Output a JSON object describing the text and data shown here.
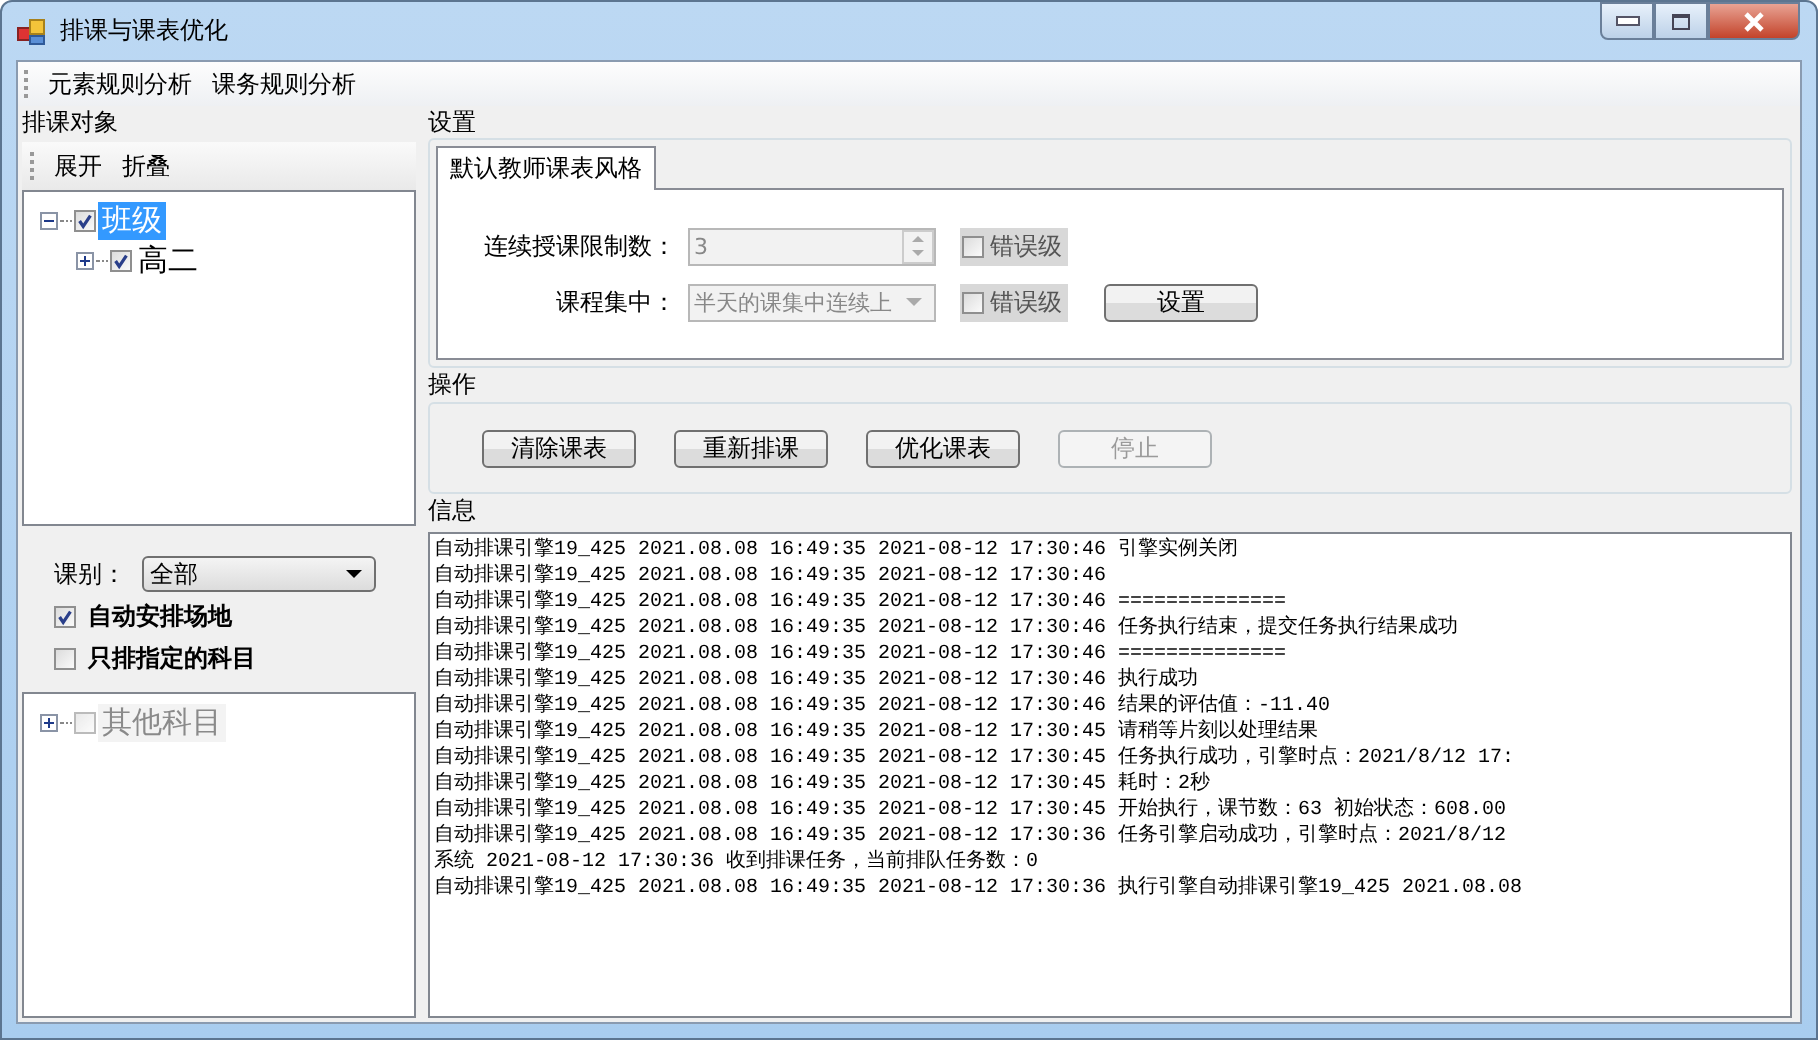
{
  "window": {
    "title": "排课与课表优化"
  },
  "menu": [
    "元素规则分析",
    "课务规则分析"
  ],
  "left": {
    "title": "排课对象",
    "toolbar": [
      "展开",
      "折叠"
    ],
    "tree": [
      {
        "label": "班级",
        "checked": true,
        "selected": true,
        "expanded": true,
        "children": [
          {
            "label": "高二",
            "checked": true,
            "selected": false,
            "expanded": false
          }
        ]
      }
    ],
    "category": {
      "label": "课别：",
      "value": "全部"
    },
    "options": [
      {
        "label": "自动安排场地",
        "checked": true
      },
      {
        "label": "只排指定的科目",
        "checked": false
      }
    ],
    "subject_tree": [
      {
        "label": "其他科目",
        "checked": false,
        "selected": false,
        "expanded": false,
        "disabled": true
      }
    ]
  },
  "settings": {
    "title": "设置",
    "tabs": [
      {
        "label": "默认教师课表风格",
        "selected": true
      }
    ],
    "fields": [
      {
        "kind": "spinner",
        "label": "连续授课限制数：",
        "value": "3",
        "disabled": true,
        "error_level": {
          "label": "错误级",
          "checked": false
        }
      },
      {
        "kind": "dropdown",
        "label": "课程集中：",
        "value": "半天的课集中连续上",
        "disabled": true,
        "error_level": {
          "label": "错误级",
          "checked": false
        }
      }
    ],
    "button": "设置"
  },
  "operations": {
    "title": "操作",
    "buttons": [
      {
        "label": "清除课表",
        "disabled": false
      },
      {
        "label": "重新排课",
        "disabled": false
      },
      {
        "label": "优化课表",
        "disabled": false
      },
      {
        "label": "停止",
        "disabled": true
      }
    ]
  },
  "info": {
    "title": "信息",
    "lines": [
      "自动排课引擎19_425 2021.08.08 16:49:35 2021-08-12 17:30:46 引擎实例关闭",
      "自动排课引擎19_425 2021.08.08 16:49:35 2021-08-12 17:30:46",
      "自动排课引擎19_425 2021.08.08 16:49:35 2021-08-12 17:30:46 ==============",
      "自动排课引擎19_425 2021.08.08 16:49:35 2021-08-12 17:30:46 任务执行结束，提交任务执行结果成功",
      "自动排课引擎19_425 2021.08.08 16:49:35 2021-08-12 17:30:46 ==============",
      "自动排课引擎19_425 2021.08.08 16:49:35 2021-08-12 17:30:46 执行成功",
      "自动排课引擎19_425 2021.08.08 16:49:35 2021-08-12 17:30:46 结果的评估值：-11.40",
      "自动排课引擎19_425 2021.08.08 16:49:35 2021-08-12 17:30:45 请稍等片刻以处理结果",
      "自动排课引擎19_425 2021.08.08 16:49:35 2021-08-12 17:30:45 任务执行成功，引擎时点：2021/8/12 17:",
      "自动排课引擎19_425 2021.08.08 16:49:35 2021-08-12 17:30:45 耗时：2秒",
      "自动排课引擎19_425 2021.08.08 16:49:35 2021-08-12 17:30:45 开始执行，课节数：63 初始状态：608.00",
      "自动排课引擎19_425 2021.08.08 16:49:35 2021-08-12 17:30:36 任务引擎启动成功，引擎时点：2021/8/12",
      "系统 2021-08-12 17:30:36 收到排课任务，当前排队任务数：0",
      "自动排课引擎19_425 2021.08.08 16:49:35 2021-08-12 17:30:36 执行引擎自动排课引擎19_425 2021.08.08"
    ]
  }
}
